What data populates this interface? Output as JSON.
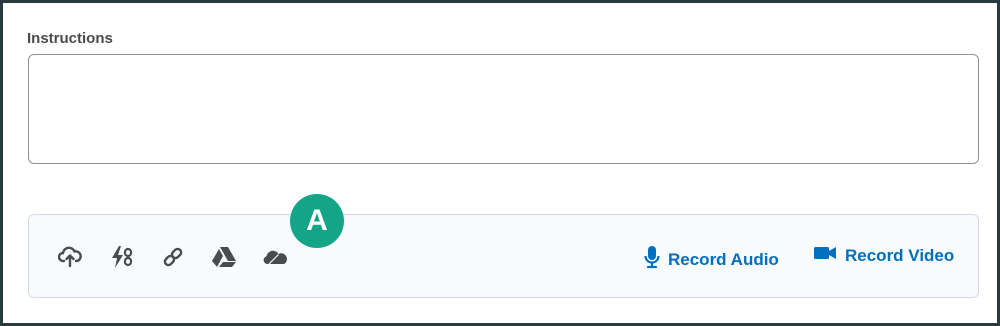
{
  "form": {
    "instructions_label": "Instructions",
    "instructions_value": ""
  },
  "attachments": {
    "tools": [
      {
        "icon": "upload-cloud-icon"
      },
      {
        "icon": "quicklink-icon"
      },
      {
        "icon": "link-icon"
      },
      {
        "icon": "google-drive-icon"
      },
      {
        "icon": "onedrive-icon"
      }
    ],
    "record_audio_label": "Record Audio",
    "record_video_label": "Record Video",
    "accent_color": "#006fbf"
  },
  "callout": {
    "label": "A",
    "color": "#14a488"
  }
}
